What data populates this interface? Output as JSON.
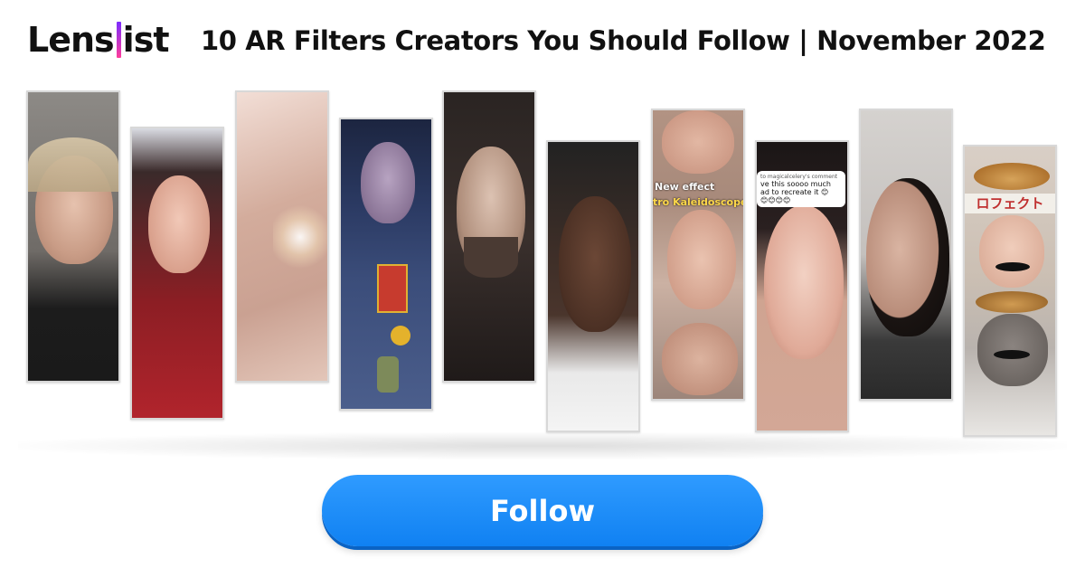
{
  "brand": {
    "logo_left": "Lens",
    "logo_right": "ist"
  },
  "headline": "10 AR Filters Creators You Should Follow | November 2022",
  "strip_1": {
    "bg": "#6b6763"
  },
  "strip_2": {
    "bg": "#8a2a30"
  },
  "strip_3": {
    "bg": "#d6b3a3"
  },
  "strip_4": {
    "bg": "#24304f"
  },
  "strip_5": {
    "bg": "#2c2826"
  },
  "strip_6": {
    "bg": "#3b3330"
  },
  "strip_7": {
    "bg": "#9a8f88",
    "caption_line1": "New effect",
    "caption_line2": "tro Kaleidoscope"
  },
  "strip_8": {
    "bg": "#c49a8a",
    "comment_header": "to magicalcelery's comment",
    "comment_line1": "ve this soooo much",
    "comment_line2": "ad to recreate it 😊",
    "comment_line3": "😊😊😊😊"
  },
  "strip_9": {
    "bg": "#c8c4c1"
  },
  "strip_10": {
    "bg": "#b9a593",
    "sign_text": "ロフェクト"
  },
  "cta": {
    "follow_label": "Follow",
    "color": "#1f8cf7"
  }
}
